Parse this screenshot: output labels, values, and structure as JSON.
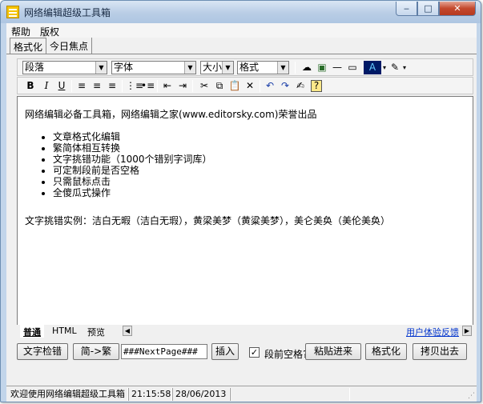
{
  "window": {
    "title": "网络编辑超级工具箱",
    "minimize_glyph": "‒",
    "maximize_glyph": "□",
    "close_glyph": "✕"
  },
  "menu": {
    "items": [
      "帮助",
      "版权"
    ]
  },
  "tabs": [
    {
      "label": "格式化",
      "active": true
    },
    {
      "label": "今日焦点",
      "active": false
    }
  ],
  "toolbar": {
    "paragraph_select": "段落",
    "font_select": "字体",
    "size_select": "大小",
    "format_select": "格式",
    "bold": "B",
    "italic": "I",
    "underline": "U"
  },
  "editor": {
    "intro": "网络编辑必备工具箱，网络编辑之家(www.editorsky.com)荣誉出品",
    "bullets": [
      "文章格式化编辑",
      "繁简体相互转换",
      "文字挑错功能（1000个错别字词库）",
      "可定制段前是否空格",
      "只需鼠标点击",
      "全傻瓜式操作"
    ],
    "example": "文字挑错实例：洁白无暇（洁白无瑕），黄梁美梦（黄粱美梦），美仑美奂（美伦美奂）"
  },
  "mode_tabs": [
    "普通",
    "HTML",
    "预览"
  ],
  "feedback_link": "用户体验反馈",
  "actions": {
    "spellcheck_button": "文字检错",
    "convert_button": "简->繁",
    "nextpage_value": "###NextPage###",
    "insert_button": "插入",
    "indent_checkbox_label": "段前空格?",
    "indent_checked": true,
    "paste_button": "粘贴进来",
    "format_button": "格式化",
    "copy_button": "拷贝出去"
  },
  "status": {
    "message": "欢迎使用网络编辑超级工具箱",
    "time": "21:15:58",
    "date": "28/06/2013"
  },
  "colors": {
    "title_bar": "#b9cde5",
    "link": "#0033cc",
    "close_button": "#c4482d"
  }
}
